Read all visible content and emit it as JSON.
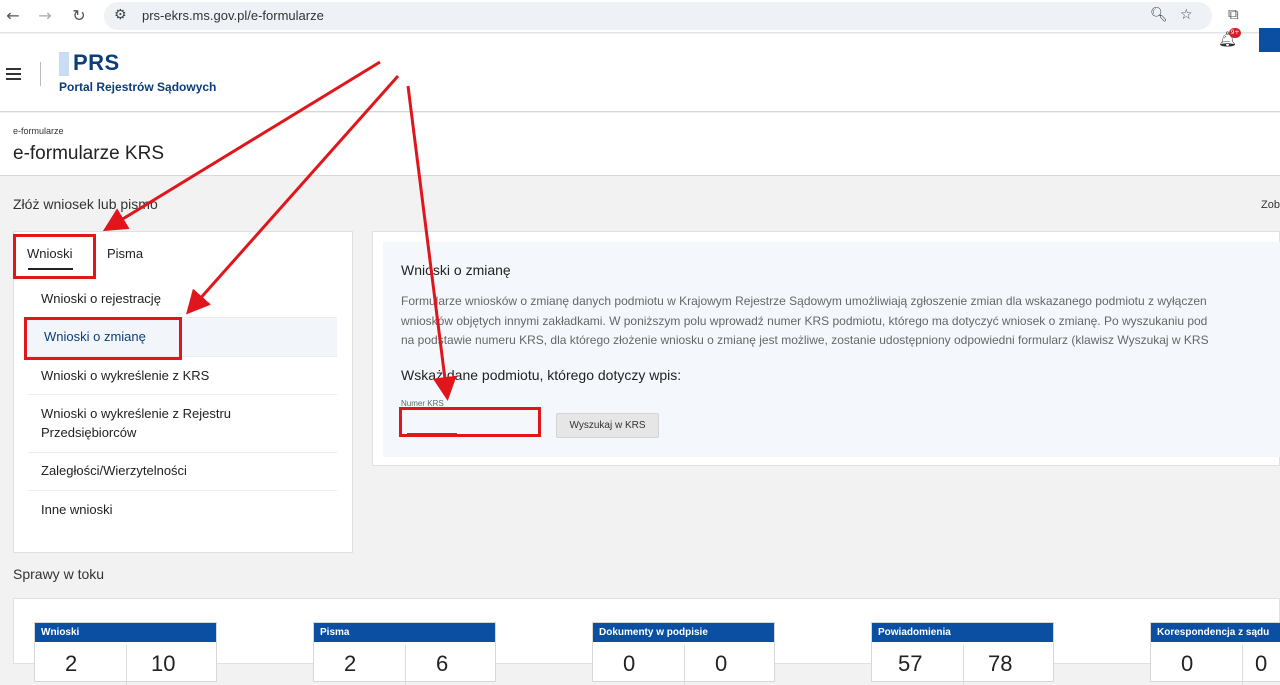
{
  "browser": {
    "url": "prs-ekrs.ms.gov.pl/e-formularze",
    "icons": [
      "back-icon",
      "forward-icon",
      "reload-icon",
      "site-info-icon",
      "zoom-icon",
      "bookmark-star-icon",
      "extensions-icon"
    ]
  },
  "header": {
    "logo_title": "PRS",
    "logo_subtitle": "Portal Rejestrów Sądowych",
    "notification_badge": "9+"
  },
  "page": {
    "breadcrumb": "e-formularze",
    "title": "e-formularze KRS",
    "section_title": "Złóż wniosek lub pismo",
    "side_link": "Zoba"
  },
  "tabs": [
    {
      "label": "Wnioski",
      "active": true
    },
    {
      "label": "Pisma",
      "active": false
    }
  ],
  "menu": [
    {
      "label": "Wnioski o rejestrację",
      "active": false
    },
    {
      "label": "Wnioski o zmianę",
      "active": true
    },
    {
      "label": "Wnioski o wykreślenie z KRS",
      "active": false
    },
    {
      "label": "Wnioski o wykreślenie z Rejestru Przedsiębiorców",
      "active": false
    },
    {
      "label": "Zaległości/Wierzytelności",
      "active": false
    },
    {
      "label": "Inne wnioski",
      "active": false
    }
  ],
  "content": {
    "title": "Wnioski o zmianę",
    "desc_line1": "Formularze wniosków o zmianę danych podmiotu w Krajowym Rejestrze Sądowym umożliwiają zgłoszenie zmian dla wskazanego podmiotu z wyłączen",
    "desc_line2": "wniosków objętych innymi zakładkami. W poniższym polu wprowadź numer KRS podmiotu, którego ma dotyczyć wniosek o zmianę. Po wyszukaniu pod",
    "desc_line3": "na podstawie numeru KRS, dla którego złożenie wniosku o zmianę jest możliwe, zostanie udostępniony odpowiedni formularz (klawisz Wyszukaj w KRS",
    "subtitle": "Wskaż dane podmiotu, którego dotyczy wpis:",
    "krs_label": "Numer KRS",
    "krs_value": "",
    "search_button": "Wyszukaj w KRS"
  },
  "cases": {
    "title": "Sprawy w toku",
    "cards": [
      {
        "label": "Wnioski",
        "left": "2",
        "right": "10"
      },
      {
        "label": "Pisma",
        "left": "2",
        "right": "6"
      },
      {
        "label": "Dokumenty w podpisie",
        "left": "0",
        "right": "0"
      },
      {
        "label": "Powiadomienia",
        "left": "57",
        "right": "78"
      },
      {
        "label": "Korespondencja z sądu",
        "left": "0",
        "right": "0"
      }
    ]
  },
  "annotation_color": "#e0161c"
}
